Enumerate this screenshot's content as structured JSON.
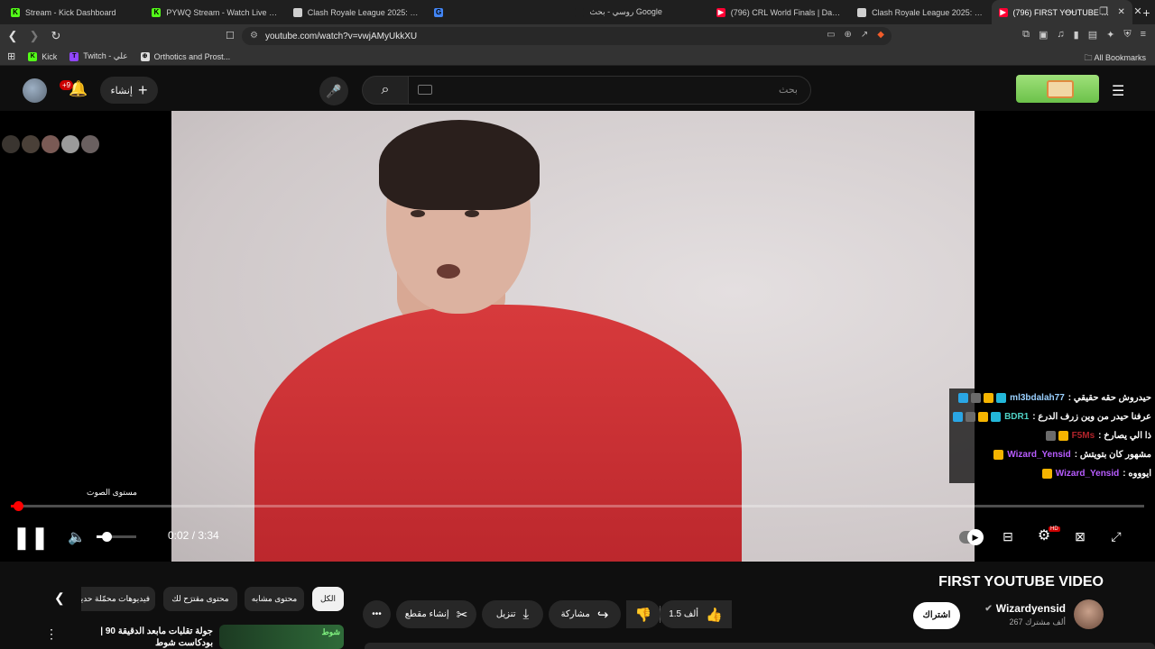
{
  "browser": {
    "tabs": [
      {
        "title": "Stream - Kick Dashboard",
        "fav": "K",
        "fav_color": "#53fc18"
      },
      {
        "title": "PYWQ Stream - Watch Live on Kick",
        "fav": "K",
        "fav_color": "#53fc18"
      },
      {
        "title": "Clash Royale League 2025: World Fin",
        "fav": "",
        "fav_color": "#cfcfcf"
      },
      {
        "title": "",
        "fav": "G",
        "fav_color": "#4285f4"
      },
      {
        "title": "روسي - بحث Google",
        "fav": "",
        "fav_color": "#1f1f1f"
      },
      {
        "title": "(796) CRL World Finals | Day 3 | Clas",
        "fav": "▶",
        "fav_color": "#ff0033"
      },
      {
        "title": "Clash Royale League 2025: World Fin",
        "fav": "",
        "fav_color": "#cfcfcf"
      },
      {
        "title": "(796) FIRST YOUTUBE VIDEO -",
        "fav": "▶",
        "fav_color": "#ff0033",
        "active": true
      }
    ],
    "url": "youtube.com/watch?v=vwjAMyUkkXU",
    "bookmarks": [
      {
        "label": "Kick",
        "icon": "K",
        "color": "#53fc18"
      },
      {
        "label": "Twitch - علي",
        "icon": "T",
        "color": "#9146ff"
      },
      {
        "label": "Orthotics and Prost...",
        "icon": "⊕",
        "color": "#dddddd"
      }
    ],
    "all_bookmarks": "All Bookmarks"
  },
  "header": {
    "notif_count": "+9",
    "create_label": "إنشاء",
    "search_placeholder": "بحث"
  },
  "chat": [
    {
      "user": "ml3bdalah77",
      "user_color": "#9ad0ff",
      "msg": "حيدروش حقه حقيقي :",
      "badges": [
        "#2aa6e5",
        "#6b6b6b",
        "#f5b400",
        "#23b7d9"
      ]
    },
    {
      "user": "BDR1",
      "user_color": "#4fd1c5",
      "msg": "عرفنا حيدر من وين زرف الدرع :",
      "badges": [
        "#2aa6e5",
        "#6b6b6b",
        "#f5b400",
        "#23b7d9"
      ]
    },
    {
      "user": "F5Ms",
      "user_color": "#b3242b",
      "msg": "ذا الي يصارخ :",
      "badges": [
        "#6b6b6b",
        "#f5b400"
      ]
    },
    {
      "user": "Wizard_Yensid",
      "user_color": "#b85cff",
      "msg": "مشهور كان بتويتش :",
      "badges": [
        "#f5b400"
      ]
    },
    {
      "user": "Wizard_Yensid",
      "user_color": "#b85cff",
      "msg": "ايوووه :",
      "badges": [
        "#f5b400"
      ]
    }
  ],
  "player": {
    "volume_tooltip": "مستوى الصوت",
    "time": "0:02 / 3:34",
    "progress_fraction": 0.005,
    "volume_fraction": 0.25
  },
  "video": {
    "title": "FIRST YOUTUBE VIDEO",
    "channel": "Wizardyensid",
    "subs": "267 ألف مشترك",
    "subscribe": "اشتراك",
    "likes": "1.5 ألف",
    "share": "مشاركة",
    "download": "تنزيل",
    "clip": "إنشاء مقطع"
  },
  "chips": [
    "الكل",
    "محتوى مشابه",
    "محتوى مقترَح لك",
    "فيديوهات محمّلة حديثًا"
  ],
  "recommendation": {
    "title": "جولة تقلبات مابعد الدقيقة 90 | بودكاست شوط",
    "badge": "شوط"
  }
}
